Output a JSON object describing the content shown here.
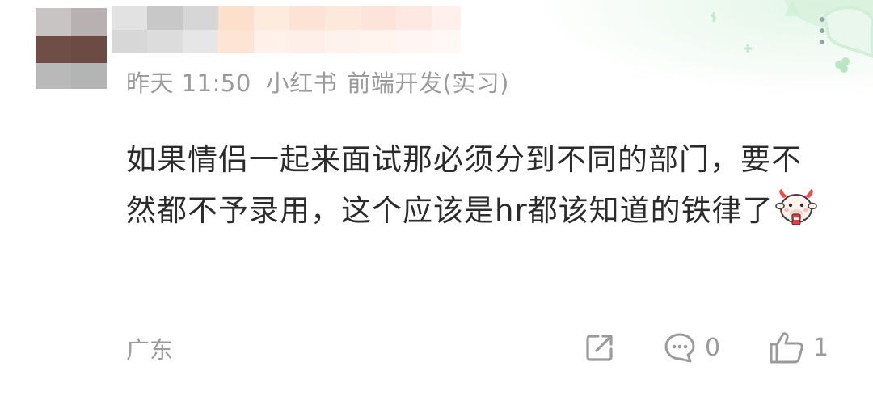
{
  "comment": {
    "time": "昨天 11:50",
    "company": "小红书",
    "position": "前端开发(实习)",
    "text": "如果情侣一起来面试那必须分到不同的部门，要不然都不予录用，这个应该是hr都该知道的铁律了",
    "location": "广东",
    "reply_count": "0",
    "like_count": "1"
  },
  "icons": {
    "share": "share-icon",
    "reply": "comment-icon",
    "like": "thumbs-up-icon",
    "more": "more-vertical-icon",
    "emoji": "cow-emoji-icon"
  },
  "colors": {
    "text": "#2b2b2b",
    "muted": "#9b9b9b",
    "decor_green": "#c8ecd0"
  }
}
